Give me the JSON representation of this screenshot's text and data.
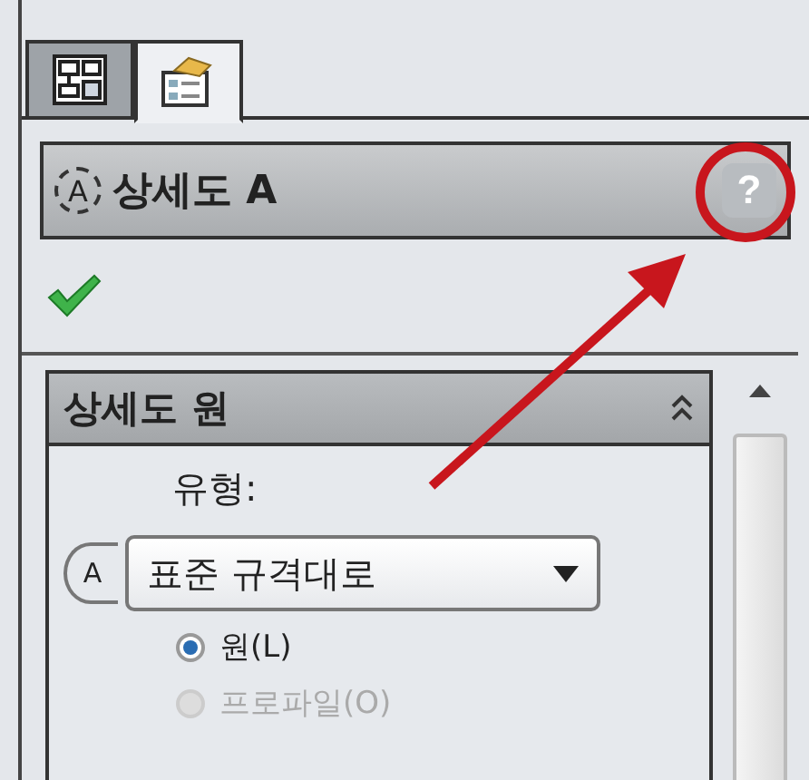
{
  "tabs": [
    {
      "kind": "feature-tree",
      "selected": false
    },
    {
      "kind": "property-manager",
      "selected": true
    }
  ],
  "title": {
    "icon_text": "A",
    "text": "상세도 A",
    "help": "?"
  },
  "group": {
    "title": "상세도 원",
    "expanded": true,
    "type_label": "유형:",
    "icon_text": "A",
    "dropdown": {
      "value": "표준 규격대로"
    },
    "options": [
      {
        "label": "원(L)",
        "selected": true,
        "disabled": false
      },
      {
        "label": "프로파일(O)",
        "selected": false,
        "disabled": true
      }
    ]
  }
}
